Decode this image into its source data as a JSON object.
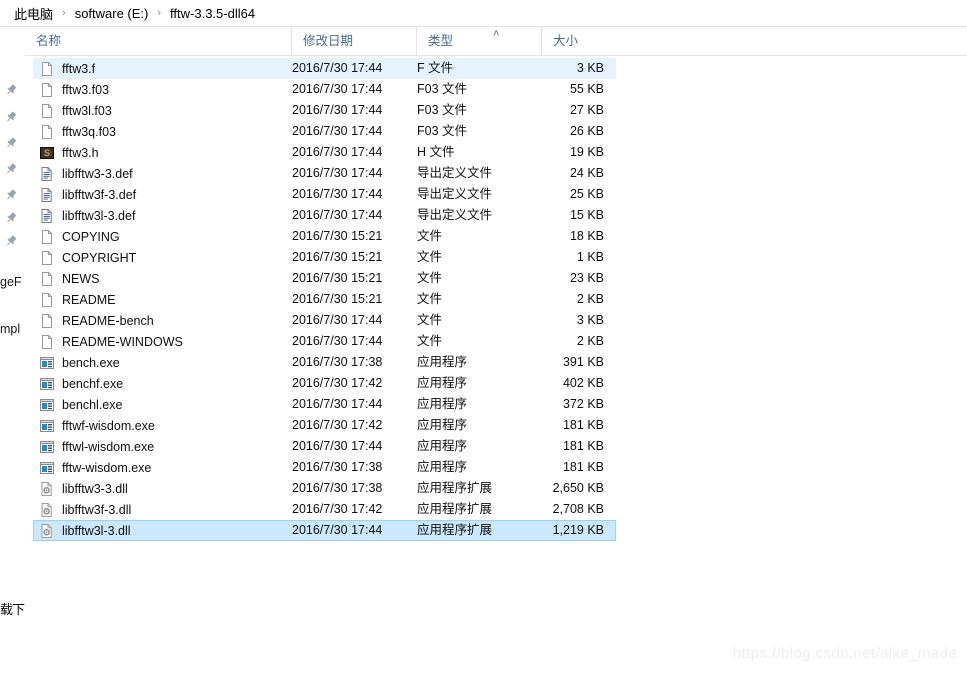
{
  "breadcrumb": {
    "separator": "›",
    "items": [
      "此电脑",
      "software (E:)",
      "fftw-3.3.5-dll64"
    ]
  },
  "columns": {
    "name": "名称",
    "date_modified": "修改日期",
    "type": "类型",
    "size": "大小",
    "sort_caret": "˄",
    "sorted_by": "类型",
    "sort_direction": "ascending"
  },
  "sidebar": {
    "pin_icon": "pin-icon",
    "fragments": [
      "geF",
      "mpl",
      "载下"
    ]
  },
  "files": [
    {
      "name": "fftw3.f",
      "date": "2016/7/30 17:44",
      "type": "F 文件",
      "size": "3 KB",
      "icon": "blank-document-icon",
      "state": "focused"
    },
    {
      "name": "fftw3.f03",
      "date": "2016/7/30 17:44",
      "type": "F03 文件",
      "size": "55 KB",
      "icon": "blank-document-icon",
      "state": "normal"
    },
    {
      "name": "fftw3l.f03",
      "date": "2016/7/30 17:44",
      "type": "F03 文件",
      "size": "27 KB",
      "icon": "blank-document-icon",
      "state": "normal"
    },
    {
      "name": "fftw3q.f03",
      "date": "2016/7/30 17:44",
      "type": "F03 文件",
      "size": "26 KB",
      "icon": "blank-document-icon",
      "state": "normal"
    },
    {
      "name": "fftw3.h",
      "date": "2016/7/30 17:44",
      "type": "H 文件",
      "size": "19 KB",
      "icon": "source-header-icon",
      "state": "normal"
    },
    {
      "name": "libfftw3-3.def",
      "date": "2016/7/30 17:44",
      "type": "导出定义文件",
      "size": "24 KB",
      "icon": "text-document-icon",
      "state": "normal"
    },
    {
      "name": "libfftw3f-3.def",
      "date": "2016/7/30 17:44",
      "type": "导出定义文件",
      "size": "25 KB",
      "icon": "text-document-icon",
      "state": "normal"
    },
    {
      "name": "libfftw3l-3.def",
      "date": "2016/7/30 17:44",
      "type": "导出定义文件",
      "size": "15 KB",
      "icon": "text-document-icon",
      "state": "normal"
    },
    {
      "name": "COPYING",
      "date": "2016/7/30 15:21",
      "type": "文件",
      "size": "18 KB",
      "icon": "blank-document-icon",
      "state": "normal"
    },
    {
      "name": "COPYRIGHT",
      "date": "2016/7/30 15:21",
      "type": "文件",
      "size": "1 KB",
      "icon": "blank-document-icon",
      "state": "normal"
    },
    {
      "name": "NEWS",
      "date": "2016/7/30 15:21",
      "type": "文件",
      "size": "23 KB",
      "icon": "blank-document-icon",
      "state": "normal"
    },
    {
      "name": "README",
      "date": "2016/7/30 15:21",
      "type": "文件",
      "size": "2 KB",
      "icon": "blank-document-icon",
      "state": "normal"
    },
    {
      "name": "README-bench",
      "date": "2016/7/30 17:44",
      "type": "文件",
      "size": "3 KB",
      "icon": "blank-document-icon",
      "state": "normal"
    },
    {
      "name": "README-WINDOWS",
      "date": "2016/7/30 17:44",
      "type": "文件",
      "size": "2 KB",
      "icon": "blank-document-icon",
      "state": "normal"
    },
    {
      "name": "bench.exe",
      "date": "2016/7/30 17:38",
      "type": "应用程序",
      "size": "391 KB",
      "icon": "application-icon",
      "state": "normal"
    },
    {
      "name": "benchf.exe",
      "date": "2016/7/30 17:42",
      "type": "应用程序",
      "size": "402 KB",
      "icon": "application-icon",
      "state": "normal"
    },
    {
      "name": "benchl.exe",
      "date": "2016/7/30 17:44",
      "type": "应用程序",
      "size": "372 KB",
      "icon": "application-icon",
      "state": "normal"
    },
    {
      "name": "fftwf-wisdom.exe",
      "date": "2016/7/30 17:42",
      "type": "应用程序",
      "size": "181 KB",
      "icon": "application-icon",
      "state": "normal"
    },
    {
      "name": "fftwl-wisdom.exe",
      "date": "2016/7/30 17:44",
      "type": "应用程序",
      "size": "181 KB",
      "icon": "application-icon",
      "state": "normal"
    },
    {
      "name": "fftw-wisdom.exe",
      "date": "2016/7/30 17:38",
      "type": "应用程序",
      "size": "181 KB",
      "icon": "application-icon",
      "state": "normal"
    },
    {
      "name": "libfftw3-3.dll",
      "date": "2016/7/30 17:38",
      "type": "应用程序扩展",
      "size": "2,650 KB",
      "icon": "dll-icon",
      "state": "normal"
    },
    {
      "name": "libfftw3f-3.dll",
      "date": "2016/7/30 17:42",
      "type": "应用程序扩展",
      "size": "2,708 KB",
      "icon": "dll-icon",
      "state": "normal"
    },
    {
      "name": "libfftw3l-3.dll",
      "date": "2016/7/30 17:44",
      "type": "应用程序扩展",
      "size": "1,219 KB",
      "icon": "dll-icon",
      "state": "selected"
    }
  ],
  "watermark": "https://blog.csdn.net/alxe_made",
  "colors": {
    "selection_fill": "#cce8ff",
    "selection_border": "#99d1ff",
    "focus_fill": "#e5f3ff",
    "header_text": "#4a6c8f",
    "accent_blue": "#1e90d2"
  }
}
